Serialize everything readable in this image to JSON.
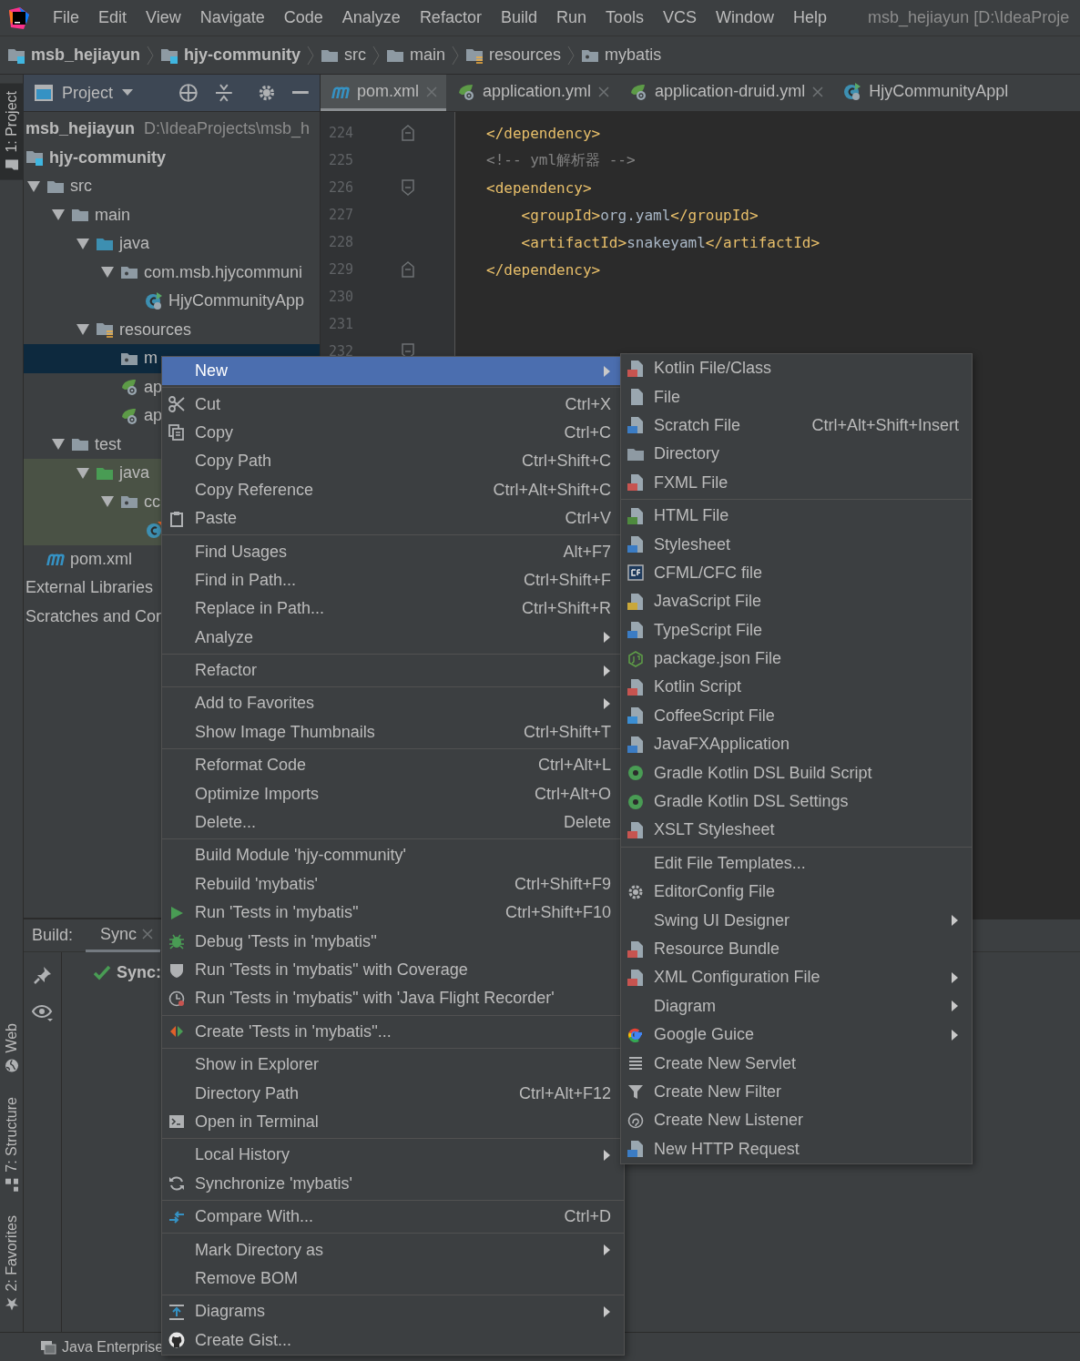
{
  "menu_bar": {
    "items": [
      "File",
      "Edit",
      "View",
      "Navigate",
      "Code",
      "Analyze",
      "Refactor",
      "Build",
      "Run",
      "Tools",
      "VCS",
      "Window",
      "Help"
    ],
    "title": "msb_hejiayun [D:\\IdeaProje"
  },
  "breadcrumb": [
    {
      "label": "msb_hejiayun",
      "kind": "module"
    },
    {
      "label": "hjy-community",
      "kind": "module"
    },
    {
      "label": "src",
      "kind": "folder"
    },
    {
      "label": "main",
      "kind": "folder"
    },
    {
      "label": "resources",
      "kind": "resources"
    },
    {
      "label": "mybatis",
      "kind": "package"
    }
  ],
  "tool_strip": [
    {
      "label": "1: Project",
      "kind": "project",
      "selected": true
    },
    {
      "label": "Web",
      "kind": "web",
      "selected": false
    },
    {
      "label": "7: Structure",
      "kind": "structure",
      "selected": false
    },
    {
      "label": "2: Favorites",
      "kind": "favorites",
      "selected": false
    }
  ],
  "project_panel": {
    "title": "Project",
    "tree": [
      {
        "label": "msb_hejiayun",
        "path": "D:\\IdeaProjects\\msb_h",
        "kind": "root",
        "selected": false,
        "highlighted": false
      },
      {
        "label": "hjy-community",
        "kind": "module",
        "selected": false,
        "highlighted": false,
        "children": [
          {
            "label": "src",
            "kind": "folder",
            "expanded": true,
            "selected": false,
            "highlighted": false,
            "children": [
              {
                "label": "main",
                "kind": "folder",
                "expanded": true,
                "selected": false,
                "highlighted": false,
                "children": [
                  {
                    "label": "java",
                    "kind": "source",
                    "expanded": true,
                    "selected": false,
                    "highlighted": false,
                    "children": [
                      {
                        "label": "com.msb.hjycommuni",
                        "kind": "package",
                        "expanded": true,
                        "selected": false,
                        "highlighted": false,
                        "children": [
                          {
                            "label": "HjyCommunityApp",
                            "kind": "spring-class",
                            "selected": false,
                            "highlighted": false
                          }
                        ]
                      }
                    ]
                  },
                  {
                    "label": "resources",
                    "kind": "resources",
                    "expanded": true,
                    "selected": false,
                    "highlighted": false,
                    "children": [
                      {
                        "label": "m",
                        "kind": "package",
                        "selected": true,
                        "highlighted": false
                      },
                      {
                        "label": "ap",
                        "kind": "spring",
                        "selected": false,
                        "highlighted": false
                      },
                      {
                        "label": "ap",
                        "kind": "spring",
                        "selected": false,
                        "highlighted": false
                      }
                    ]
                  }
                ]
              },
              {
                "label": "test",
                "kind": "folder",
                "expanded": true,
                "selected": false,
                "highlighted": false,
                "children": [
                  {
                    "label": "java",
                    "kind": "test-source",
                    "expanded": true,
                    "selected": false,
                    "highlighted": true,
                    "children": [
                      {
                        "label": "cc",
                        "kind": "package",
                        "expanded": true,
                        "selected": false,
                        "highlighted": true,
                        "children": [
                          {
                            "kind": "test-class",
                            "selected": false,
                            "highlighted": true
                          }
                        ]
                      }
                    ]
                  }
                ]
              }
            ]
          },
          {
            "label": "pom.xml",
            "kind": "maven",
            "selected": false,
            "highlighted": false
          }
        ]
      },
      {
        "label": "External Libraries",
        "kind": "none",
        "selected": false,
        "highlighted": false
      },
      {
        "label": "Scratches and Cor",
        "kind": "none",
        "selected": false,
        "highlighted": false
      }
    ]
  },
  "editor": {
    "tabs": [
      {
        "label": "pom.xml",
        "kind": "maven",
        "selected": true,
        "closable": true
      },
      {
        "label": "application.yml",
        "kind": "spring",
        "selected": false,
        "closable": true
      },
      {
        "label": "application-druid.yml",
        "kind": "spring",
        "selected": false,
        "closable": true
      },
      {
        "label": "HjyCommunityAppl",
        "kind": "spring-class",
        "selected": false,
        "closable": false
      }
    ],
    "lines": [
      {
        "number": "224",
        "kind": "fold-end",
        "segments": [
          {
            "kind": "tag",
            "text": "</dependency>"
          }
        ]
      },
      {
        "number": "225",
        "kind": "plain",
        "segments": [
          {
            "kind": "comment",
            "text": "<!-- yml解析器 -->"
          }
        ]
      },
      {
        "number": "226",
        "kind": "fold-start",
        "segments": [
          {
            "kind": "tag",
            "text": "<dependency>"
          }
        ]
      },
      {
        "number": "227",
        "kind": "plain",
        "segments": [
          {
            "kind": "tag",
            "text": "    <groupId>"
          },
          {
            "kind": "text",
            "text": "org.yaml"
          },
          {
            "kind": "tag",
            "text": "</groupId>"
          }
        ]
      },
      {
        "number": "228",
        "kind": "plain",
        "segments": [
          {
            "kind": "tag",
            "text": "    <artifactId>"
          },
          {
            "kind": "text",
            "text": "snakeyaml"
          },
          {
            "kind": "tag",
            "text": "</artifactId>"
          }
        ]
      },
      {
        "number": "229",
        "kind": "fold-end",
        "segments": [
          {
            "kind": "tag",
            "text": "</dependency>"
          }
        ]
      },
      {
        "number": "230",
        "kind": "plain"
      },
      {
        "number": "231",
        "kind": "plain"
      },
      {
        "number": "232",
        "kind": "fold-start"
      }
    ]
  },
  "build": {
    "label": "Build:",
    "tabs": [
      {
        "label": "Sync",
        "selected": true
      }
    ],
    "message": "Sync:"
  },
  "status_bar": {
    "text": "Java Enterprise"
  },
  "context_menu": {
    "groups": [
      [
        {
          "label": "New",
          "kind": "plain",
          "submenu": true,
          "selected": true
        }
      ],
      [
        {
          "label": "Cut",
          "shortcut": "Ctrl+X",
          "kind": "cut",
          "submenu": false,
          "selected": false
        },
        {
          "label": "Copy",
          "shortcut": "Ctrl+C",
          "kind": "copy",
          "submenu": false,
          "selected": false
        },
        {
          "label": "Copy Path",
          "shortcut": "Ctrl+Shift+C",
          "kind": "plain",
          "submenu": false,
          "selected": false
        },
        {
          "label": "Copy Reference",
          "shortcut": "Ctrl+Alt+Shift+C",
          "kind": "plain",
          "submenu": false,
          "selected": false
        },
        {
          "label": "Paste",
          "shortcut": "Ctrl+V",
          "kind": "paste",
          "submenu": false,
          "selected": false
        }
      ],
      [
        {
          "label": "Find Usages",
          "shortcut": "Alt+F7",
          "kind": "plain",
          "submenu": false,
          "selected": false
        },
        {
          "label": "Find in Path...",
          "shortcut": "Ctrl+Shift+F",
          "kind": "plain",
          "submenu": false,
          "selected": false
        },
        {
          "label": "Replace in Path...",
          "shortcut": "Ctrl+Shift+R",
          "kind": "plain",
          "submenu": false,
          "selected": false
        },
        {
          "label": "Analyze",
          "kind": "plain",
          "submenu": true,
          "selected": false
        }
      ],
      [
        {
          "label": "Refactor",
          "kind": "plain",
          "submenu": true,
          "selected": false
        }
      ],
      [
        {
          "label": "Add to Favorites",
          "kind": "plain",
          "submenu": true,
          "selected": false
        },
        {
          "label": "Show Image Thumbnails",
          "shortcut": "Ctrl+Shift+T",
          "kind": "plain",
          "submenu": false,
          "selected": false
        }
      ],
      [
        {
          "label": "Reformat Code",
          "shortcut": "Ctrl+Alt+L",
          "kind": "plain",
          "submenu": false,
          "selected": false
        },
        {
          "label": "Optimize Imports",
          "shortcut": "Ctrl+Alt+O",
          "kind": "plain",
          "submenu": false,
          "selected": false
        },
        {
          "label": "Delete...",
          "shortcut": "Delete",
          "kind": "plain",
          "submenu": false,
          "selected": false
        }
      ],
      [
        {
          "label": "Build Module 'hjy-community'",
          "kind": "plain",
          "submenu": false,
          "selected": false
        },
        {
          "label": "Rebuild 'mybatis'",
          "shortcut": "Ctrl+Shift+F9",
          "kind": "plain",
          "submenu": false,
          "selected": false
        },
        {
          "label": "Run 'Tests in 'mybatis''",
          "shortcut": "Ctrl+Shift+F10",
          "kind": "run",
          "submenu": false,
          "selected": false
        },
        {
          "label": "Debug 'Tests in 'mybatis''",
          "kind": "debug",
          "submenu": false,
          "selected": false
        },
        {
          "label": "Run 'Tests in 'mybatis'' with Coverage",
          "kind": "coverage",
          "submenu": false,
          "selected": false
        },
        {
          "label": "Run 'Tests in 'mybatis'' with 'Java Flight Recorder'",
          "kind": "profiler",
          "submenu": false,
          "selected": false
        }
      ],
      [
        {
          "label": "Create 'Tests in 'mybatis''...",
          "kind": "create-test",
          "submenu": false,
          "selected": false
        }
      ],
      [
        {
          "label": "Show in Explorer",
          "kind": "plain",
          "submenu": false,
          "selected": false
        },
        {
          "label": "Directory Path",
          "shortcut": "Ctrl+Alt+F12",
          "kind": "plain",
          "submenu": false,
          "selected": false
        },
        {
          "label": "Open in Terminal",
          "kind": "terminal",
          "submenu": false,
          "selected": false
        }
      ],
      [
        {
          "label": "Local History",
          "kind": "plain",
          "submenu": true,
          "selected": false
        },
        {
          "label": "Synchronize 'mybatis'",
          "kind": "sync",
          "submenu": false,
          "selected": false
        }
      ],
      [
        {
          "label": "Compare With...",
          "shortcut": "Ctrl+D",
          "kind": "compare",
          "submenu": false,
          "selected": false
        }
      ],
      [
        {
          "label": "Mark Directory as",
          "kind": "plain",
          "submenu": true,
          "selected": false
        },
        {
          "label": "Remove BOM",
          "kind": "plain",
          "submenu": false,
          "selected": false
        }
      ],
      [
        {
          "label": "Diagrams",
          "kind": "diagram",
          "submenu": true,
          "selected": false
        },
        {
          "label": "Create Gist...",
          "kind": "github",
          "submenu": false,
          "selected": false
        }
      ]
    ]
  },
  "submenu": {
    "groups": [
      [
        {
          "label": "Kotlin File/Class",
          "kind": "kotlin",
          "submenu": false,
          "selected": false
        },
        {
          "label": "File",
          "kind": "file",
          "submenu": false,
          "selected": false
        },
        {
          "label": "Scratch File",
          "shortcut": "Ctrl+Alt+Shift+Insert",
          "kind": "scratch",
          "submenu": false,
          "selected": false
        },
        {
          "label": "Directory",
          "kind": "folder",
          "submenu": false,
          "selected": false
        },
        {
          "label": "FXML File",
          "kind": "fxml",
          "submenu": false,
          "selected": false
        }
      ],
      [
        {
          "label": "HTML File",
          "kind": "html",
          "submenu": false,
          "selected": false
        },
        {
          "label": "Stylesheet",
          "kind": "css",
          "submenu": false,
          "selected": false
        },
        {
          "label": "CFML/CFC file",
          "kind": "cfml",
          "submenu": false,
          "selected": false
        },
        {
          "label": "JavaScript File",
          "kind": "js",
          "submenu": false,
          "selected": false
        },
        {
          "label": "TypeScript File",
          "kind": "ts",
          "submenu": false,
          "selected": false
        },
        {
          "label": "package.json File",
          "kind": "packagejson",
          "submenu": false,
          "selected": false
        },
        {
          "label": "Kotlin Script",
          "kind": "kotlin",
          "submenu": false,
          "selected": false
        },
        {
          "label": "CoffeeScript File",
          "kind": "coffee",
          "submenu": false,
          "selected": false
        },
        {
          "label": "JavaFXApplication",
          "kind": "javafx",
          "submenu": false,
          "selected": false
        },
        {
          "label": "Gradle Kotlin DSL Build Script",
          "kind": "gradle",
          "submenu": false,
          "selected": false
        },
        {
          "label": "Gradle Kotlin DSL Settings",
          "kind": "gradle",
          "submenu": false,
          "selected": false
        },
        {
          "label": "XSLT Stylesheet",
          "kind": "xslt",
          "submenu": false,
          "selected": false
        }
      ],
      [
        {
          "label": "Edit File Templates...",
          "kind": "plain",
          "submenu": false,
          "selected": false
        },
        {
          "label": "EditorConfig File",
          "kind": "gear",
          "submenu": false,
          "selected": false
        },
        {
          "label": "Swing UI Designer",
          "kind": "plain",
          "submenu": true,
          "selected": false
        },
        {
          "label": "Resource Bundle",
          "kind": "bundle",
          "submenu": false,
          "selected": false
        },
        {
          "label": "XML Configuration File",
          "kind": "xml",
          "submenu": true,
          "selected": false
        },
        {
          "label": "Diagram",
          "kind": "plain",
          "submenu": true,
          "selected": false
        },
        {
          "label": "Google Guice",
          "kind": "google",
          "submenu": true,
          "selected": false
        },
        {
          "label": "Create New Servlet",
          "kind": "servlet",
          "submenu": false,
          "selected": false
        },
        {
          "label": "Create New Filter",
          "kind": "filter",
          "submenu": false,
          "selected": false
        },
        {
          "label": "Create New Listener",
          "kind": "listener",
          "submenu": false,
          "selected": false
        },
        {
          "label": "New HTTP Request",
          "kind": "http",
          "submenu": false,
          "selected": false
        }
      ]
    ]
  }
}
